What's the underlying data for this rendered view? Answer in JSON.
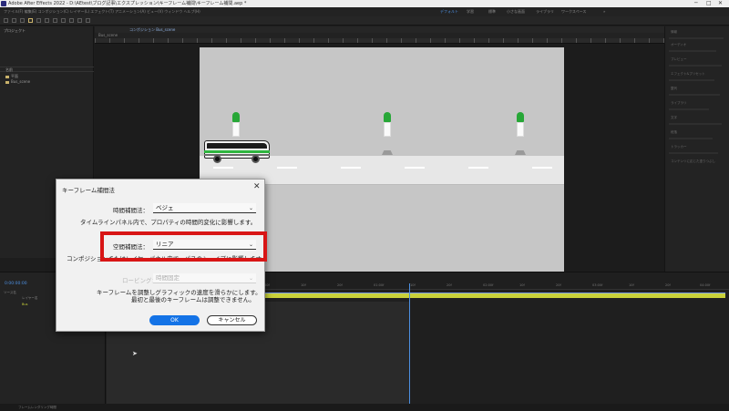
{
  "window": {
    "title": "Adobe After Effects 2022 - D:\\AEtest\\ブログ記事\\エクスプレッション\\キーフレーム補間\\キーフレーム補間.aep *",
    "controls": [
      "─",
      "□",
      "✕"
    ]
  },
  "menu": {
    "items": "ファイル(F)  編集(E)  コンポジション(C)  レイヤー(L)  エフェクト(T)  アニメーション(A)  ビュー(V)  ウィンドウ  ヘルプ(H)"
  },
  "workspaces": {
    "items": [
      "デフォルト",
      "学習",
      "標準",
      "小さな画面",
      "ライブラリ",
      "ワークスペース",
      "»"
    ],
    "active_index": 0
  },
  "project_panel": {
    "tab": "プロジェクト",
    "column_header": "名前",
    "items": [
      "平面",
      "Bus_scene"
    ]
  },
  "viewer": {
    "tab": "コンポジション Bus_scene",
    "crumb": "Bus_scene"
  },
  "right_panel": {
    "labels": [
      "情報",
      "オーディオ",
      "プレビュー",
      "エフェクト&プリセット",
      "整列",
      "ライブラリ",
      "文字",
      "段落",
      "トラッカー",
      "コンテンツに応じた塗りつぶし"
    ]
  },
  "timeline": {
    "timecode": "0:00:00:00",
    "rows": [
      "ソース名",
      "レイヤー名",
      "Bus"
    ],
    "ruler": [
      "00f",
      "10f",
      "20f",
      "01:00f",
      "10f",
      "20f",
      "02:00f",
      "10f",
      "20f",
      "03:00f",
      "10f",
      "20f",
      "04:00f"
    ],
    "status": "フレームレンダリング時間"
  },
  "dialog": {
    "title": "キーフレーム補間法",
    "temporal_label": "時間補間法：",
    "temporal_value": "ベジェ",
    "temporal_note": "タイムラインパネル内で、プロパティの時間的変化に影響します。",
    "spatial_label": "空間補間法：",
    "spatial_value": "リニア",
    "spatial_note": "コンポジションまたはレイヤーパネル内で、パスのシェイプに影響します。",
    "roving_label": "ロービング：",
    "roving_value": "時間固定",
    "roving_note1": "キーフレームを調整しグラフィックの速度を滑らかにします。",
    "roving_note2": "最初と最後のキーフレームは調整できません。",
    "ok_label": "OK",
    "cancel_label": "キャンセル",
    "close_glyph": "✕"
  },
  "colors": {
    "accent": "#1473e6",
    "highlight": "#d81515",
    "bus_green": "#2fb53f",
    "work_area": "#c9d13a"
  }
}
